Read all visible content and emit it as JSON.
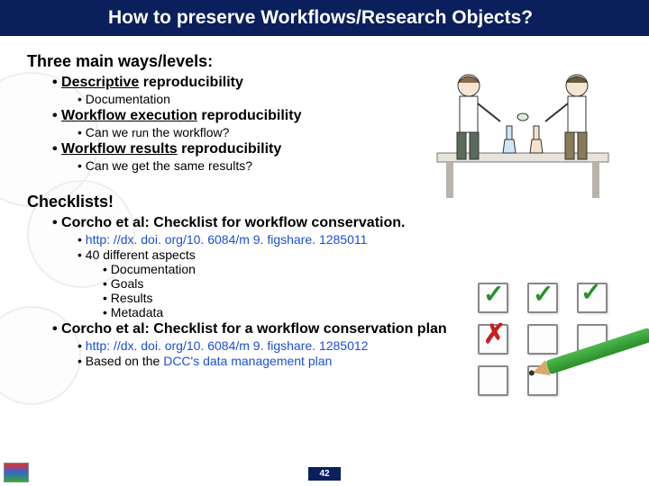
{
  "title": "How to preserve Workflows/Research Objects?",
  "section1": {
    "heading": "Three main ways/levels:",
    "items": [
      {
        "em": "Descriptive",
        "rest": " reproducibility",
        "sub": [
          "Documentation"
        ]
      },
      {
        "em": "Workflow execution",
        "rest": " reproducibility",
        "sub_run": [
          {
            "pre": "Can we ",
            "run": "run",
            "post": " the workflow?"
          }
        ]
      },
      {
        "em": "Workflow results",
        "rest": " reproducibility",
        "sub": [
          "Can we get the same results?"
        ]
      }
    ]
  },
  "section2": {
    "heading": "Checklists!",
    "items": [
      {
        "label": "Corcho et al: Checklist for workflow conservation.",
        "sub": [
          {
            "text": "http: //dx. doi. org/10. 6084/m 9. figshare. 1285011",
            "link": true
          },
          {
            "text": "40 different aspects"
          }
        ],
        "sub2": [
          "Documentation",
          "Goals",
          "Results",
          "Metadata"
        ]
      },
      {
        "label": "Corcho et al: Checklist for a workflow conservation plan",
        "sub": [
          {
            "text": "http: //dx. doi. org/10. 6084/m 9. figshare. 1285012",
            "link": true
          },
          {
            "text_pre": "Based on the ",
            "link_text": "DCC's data management plan"
          }
        ]
      }
    ]
  },
  "page": "42"
}
